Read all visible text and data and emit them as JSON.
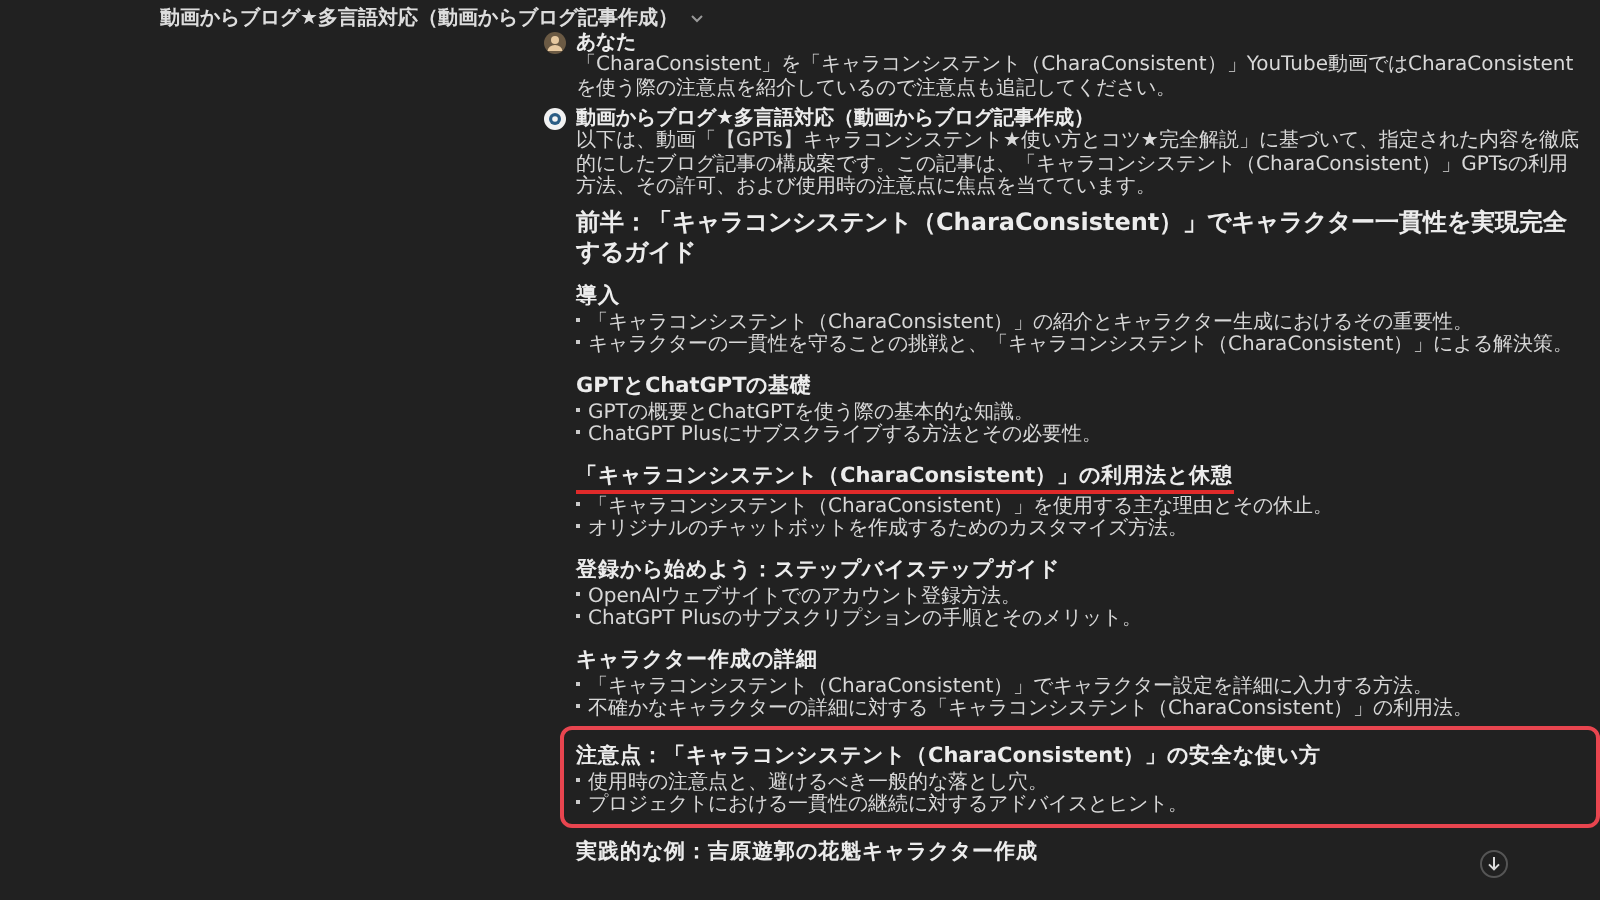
{
  "header": {
    "title": "動画からブログ★多言語対応（動画からブログ記事作成）"
  },
  "messages": [
    {
      "kind": "user",
      "author": "あなた",
      "text": "「CharaConsistent」を「キャラコンシステント（CharaConsistent）」YouTube動画ではCharaConsistentを使う際の注意点を紹介しているので注意点も追記してください。"
    },
    {
      "kind": "assistant",
      "author": "動画からブログ★多言語対応（動画からブログ記事作成）",
      "text": "以下は、動画「【GPTs】キャラコンシステント★使い方とコツ★完全解説」に基づいて、指定された内容を徹底的にしたブログ記事の構成案です。この記事は、「キャラコンシステント（CharaConsistent）」GPTsの利用方法、その許可、および使用時の注意点に焦点を当てています。"
    }
  ],
  "article": {
    "title": "前半：「キャラコンシステント（CharaConsistent）」でキャラクター一貫性を実現完全するガイド",
    "sections": [
      {
        "title": "導入",
        "underlined": false,
        "highlighted": false,
        "bullets": [
          "「キャラコンシステント（CharaConsistent）」の紹介とキャラクター生成におけるその重要性。",
          "キャラクターの一貫性を守ることの挑戦と、「キャラコンシステント（CharaConsistent）」による解決策。"
        ]
      },
      {
        "title": "GPTとChatGPTの基礎",
        "underlined": false,
        "highlighted": false,
        "bullets": [
          "GPTの概要とChatGPTを使う際の基本的な知識。",
          "ChatGPT Plusにサブスクライブする方法とその必要性。"
        ]
      },
      {
        "title": "「キャラコンシステント（CharaConsistent）」の利用法と休憩",
        "underlined": true,
        "highlighted": false,
        "bullets": [
          "「キャラコンシステント（CharaConsistent）」を使用する主な理由とその休止。",
          "オリジナルのチャットボットを作成するためのカスタマイズ方法。"
        ]
      },
      {
        "title": "登録から始めよう：ステップバイステップガイド",
        "underlined": false,
        "highlighted": false,
        "bullets": [
          "OpenAIウェブサイトでのアカウント登録方法。",
          "ChatGPT Plusのサブスクリプションの手順とそのメリット。"
        ]
      },
      {
        "title": "キャラクター作成の詳細",
        "underlined": false,
        "highlighted": false,
        "bullets": [
          "「キャラコンシステント（CharaConsistent）」でキャラクター設定を詳細に入力する方法。",
          "不確かなキャラクターの詳細に対する「キャラコンシステント（CharaConsistent）」の利用法。"
        ]
      },
      {
        "title": "注意点：「キャラコンシステント（CharaConsistent）」の安全な使い方",
        "underlined": false,
        "highlighted": true,
        "bullets": [
          "使用時の注意点と、避けるべき一般的な落とし穴。",
          "プロジェクトにおける一貫性の継続に対するアドバイスとヒント。"
        ]
      },
      {
        "title": "実践的な例：吉原遊郭の花魁キャラクター作成",
        "underlined": false,
        "highlighted": false
      }
    ]
  }
}
